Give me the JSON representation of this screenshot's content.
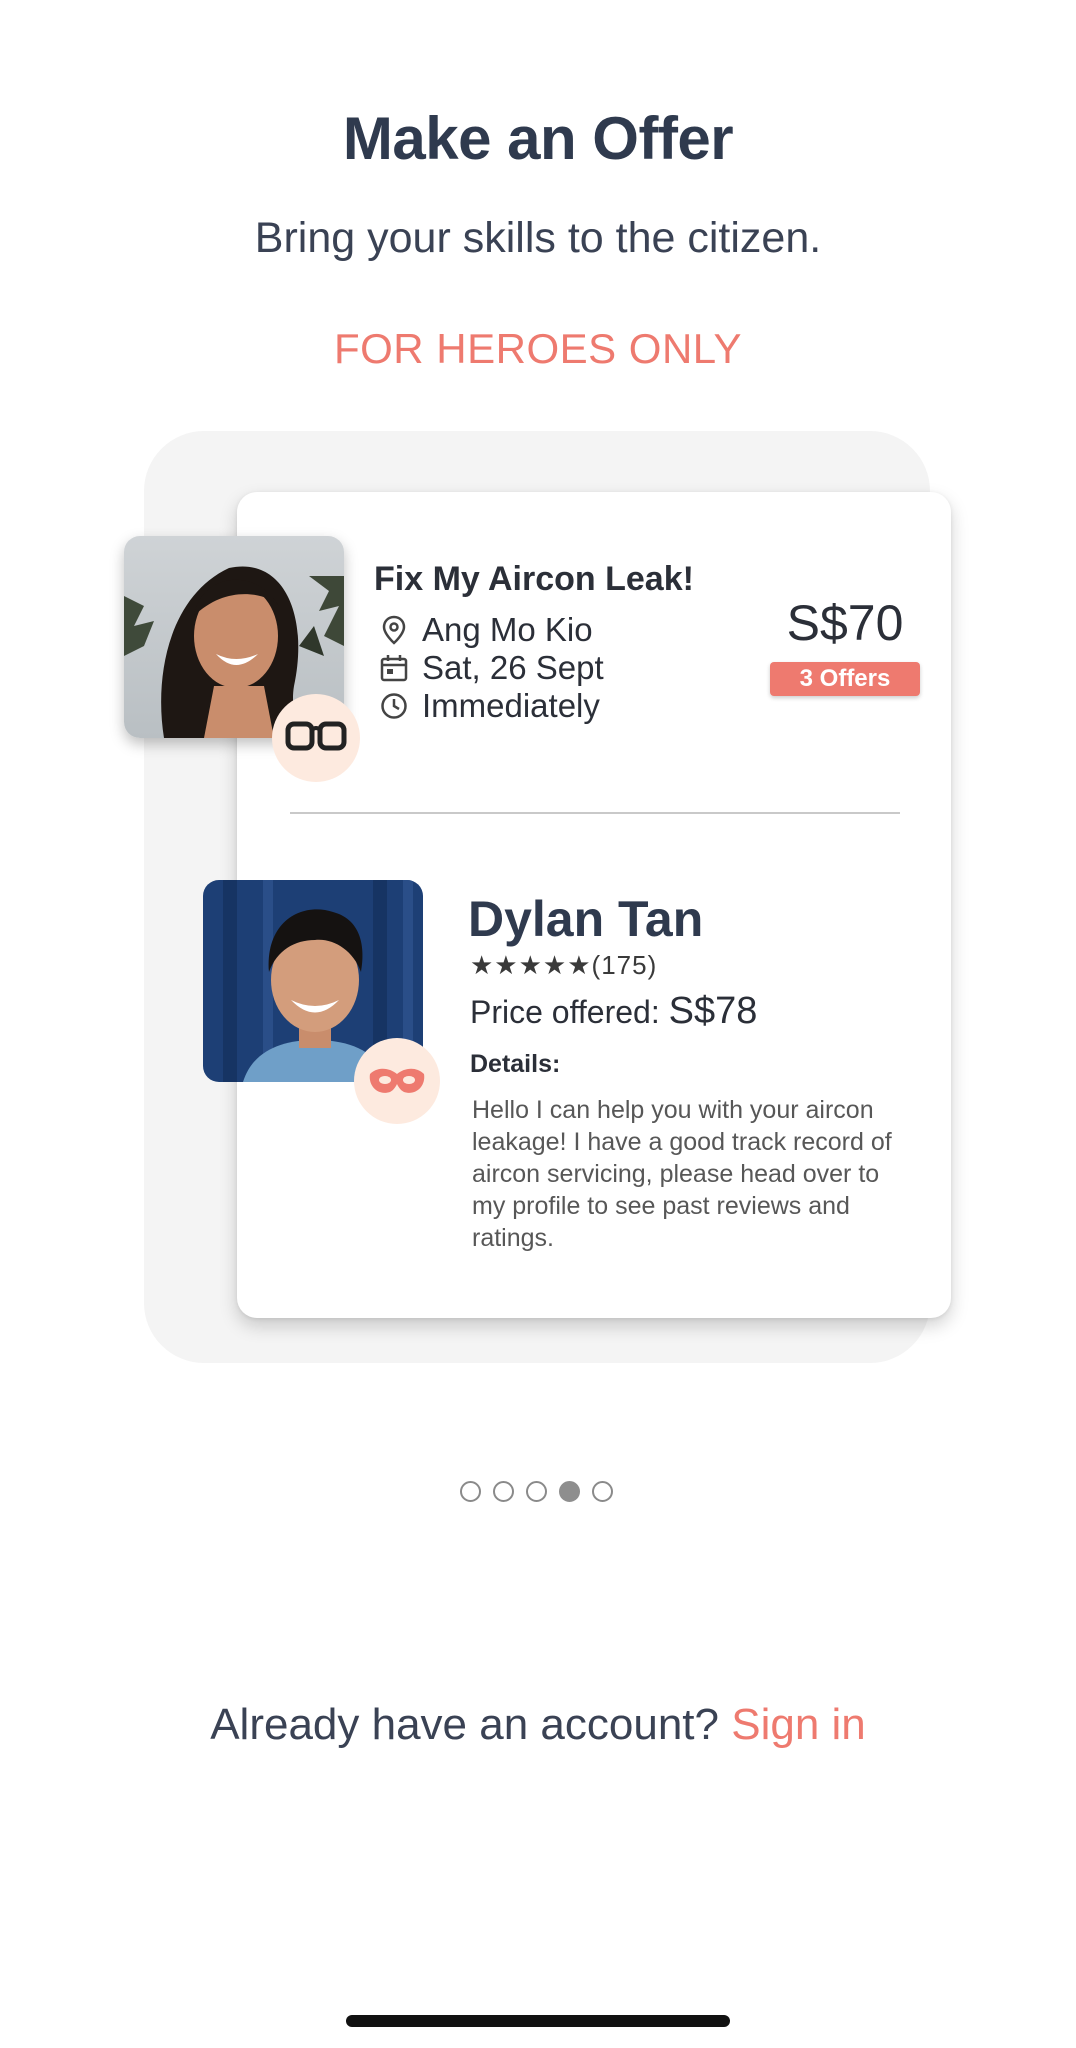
{
  "header": {
    "title": "Make an Offer",
    "subtitle": "Bring your skills to the citizen.",
    "tagline": "FOR HEROES ONLY"
  },
  "job": {
    "title": "Fix My Aircon Leak!",
    "location": "Ang Mo Kio",
    "date": "Sat, 26 Sept",
    "timing": "Immediately",
    "price": "S$70",
    "offers_count": "3 Offers",
    "requester_badge_icon": "glasses-icon"
  },
  "offer": {
    "hero_name": "Dylan Tan",
    "stars": "★★★★★",
    "review_count": "(175)",
    "price_label": "Price offered:",
    "price_value": "S$78",
    "details_label": "Details:",
    "details_text": "Hello I can help you with your aircon leakage! I have a good track record of aircon servicing, please head over to my profile to see past reviews and ratings.",
    "hero_badge_icon": "hero-mask-icon"
  },
  "pager": {
    "total": 5,
    "active_index": 3
  },
  "footer": {
    "prompt": "Already have an account?",
    "signin_label": "Sign in"
  },
  "colors": {
    "accent": "#ee7a6f",
    "title": "#2f3a4e",
    "badge_bg": "#fdeadf"
  }
}
